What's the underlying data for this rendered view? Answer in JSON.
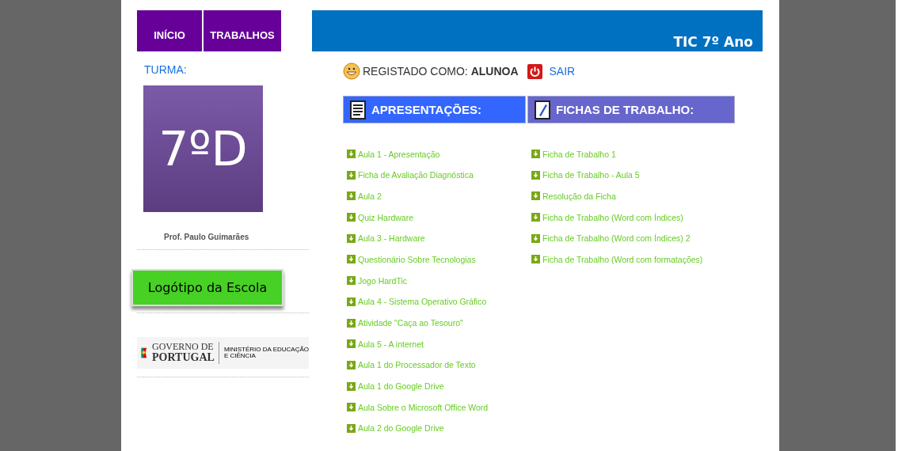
{
  "nav": {
    "items": [
      {
        "label": "INÍCIO"
      },
      {
        "label": "TRABALHOS"
      }
    ],
    "title": "TIC 7º Ano"
  },
  "sidebar": {
    "class_label": "TURMA:",
    "class_tile": "7ºD",
    "teacher": "Prof. Paulo Guimarães",
    "school_logo": "Logótipo da Escola",
    "gov_logo": {
      "line1": "GOVERNO DE",
      "line2": "PORTUGAL",
      "ministry1": "MINISTÉRIO DA EDUCAÇÃO",
      "ministry2": "E CIÊNCIA"
    }
  },
  "session": {
    "text": "REGISTADO COMO: **ALUNOA**",
    "logout": "SAIR"
  },
  "sections": [
    {
      "kind": "presentations",
      "title": "APRESENTAÇÕES:",
      "items": [
        "Aula 1 - Apresentação",
        "Ficha de Avaliação Diagnóstica",
        "Aula 2",
        "Quiz Hardware",
        "Aula 3 - Hardware",
        "Questionário Sobre Tecnologias",
        "Jogo HardTic",
        "Aula 4 - Sistema Operativo Gráfico",
        "Atividade \"Caça ao Tesouro\"",
        "Aula 5 - A internet",
        "Aula 1 do Processador de Texto",
        "Aula 1 do Google Drive",
        "Aula Sobre o Microsoft Office Word",
        "Aula 2 do Google Drive"
      ]
    },
    {
      "kind": "worksheets",
      "title": "FICHAS DE TRABALHO:",
      "items": [
        "Ficha de Trabalho 1",
        "Ficha de Trabalho - Aula 5",
        "Resolução da Ficha",
        "Ficha de Trabalho (Word com Índices)",
        "Ficha de Trabalho (Word com Índices) 2",
        "Ficha de Trabalho (Word com formatações)"
      ]
    }
  ]
}
